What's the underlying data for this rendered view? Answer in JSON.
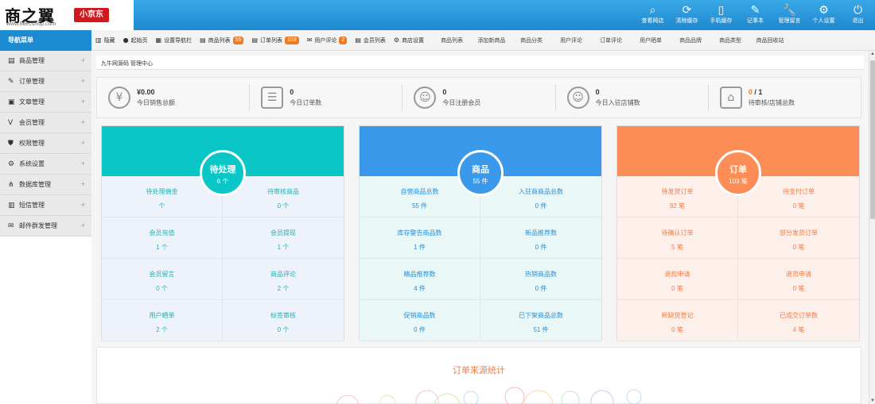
{
  "logo": {
    "main": "商之翼",
    "url": "www.68ecshop.com",
    "badge": "小京东"
  },
  "header_nav": [
    {
      "icon": "search-icon",
      "glyph": "⌕",
      "label": "查看网店"
    },
    {
      "icon": "refresh-icon",
      "glyph": "⟳",
      "label": "清除缓存"
    },
    {
      "icon": "mobile-icon",
      "glyph": "▯",
      "label": "手机缓存"
    },
    {
      "icon": "pen-icon",
      "glyph": "✎",
      "label": "记事本"
    },
    {
      "icon": "wrench-icon",
      "glyph": "🔧",
      "label": "管理留言"
    },
    {
      "icon": "gear-icon",
      "glyph": "⚙",
      "label": "个人设置"
    },
    {
      "icon": "power-icon",
      "glyph": "⏻",
      "label": "退出"
    }
  ],
  "sidebar": {
    "title": "导航菜单",
    "items": [
      {
        "icon": "goods-icon",
        "glyph": "▤",
        "label": "商品管理"
      },
      {
        "icon": "order-icon",
        "glyph": "✎",
        "label": "订单管理"
      },
      {
        "icon": "article-icon",
        "glyph": "▣",
        "label": "文章管理"
      },
      {
        "icon": "vip-icon",
        "glyph": "V",
        "label": "会员管理"
      },
      {
        "icon": "shield-icon",
        "glyph": "⛊",
        "label": "权限管理"
      },
      {
        "icon": "settings-icon",
        "glyph": "⚙",
        "label": "系统设置"
      },
      {
        "icon": "database-icon",
        "glyph": "⋔",
        "label": "数据库管理"
      },
      {
        "icon": "sms-icon",
        "glyph": "▥",
        "label": "短信管理"
      },
      {
        "icon": "mail-icon",
        "glyph": "✉",
        "label": "邮件群发管理"
      }
    ]
  },
  "tabs": [
    {
      "icon": "hide-icon",
      "glyph": "▥",
      "label": "隐藏",
      "badge": ""
    },
    {
      "icon": "home-icon",
      "glyph": "●",
      "label": "起始页",
      "badge": ""
    },
    {
      "icon": "nav-icon",
      "glyph": "▦",
      "label": "设置导航栏",
      "badge": ""
    },
    {
      "icon": "goods-list-icon",
      "glyph": "▤",
      "label": "商品列表",
      "badge": "55"
    },
    {
      "icon": "order-list-icon",
      "glyph": "▤",
      "label": "订单列表",
      "badge": "103"
    },
    {
      "icon": "comment-icon",
      "glyph": "✉",
      "label": "用户评论",
      "badge": "2"
    },
    {
      "icon": "member-icon",
      "glyph": "▤",
      "label": "会员列表",
      "badge": ""
    },
    {
      "icon": "shop-icon",
      "glyph": "⚙",
      "label": "商店设置",
      "badge": ""
    }
  ],
  "plain_tabs": [
    "商品列表",
    "添加新商品",
    "商品分类",
    "用户评论",
    "订单评论",
    "用户晒单",
    "商品品牌",
    "商品类型",
    "商品回收站"
  ],
  "breadcrumb": "九牛网源码 管理中心",
  "stats": [
    {
      "icon": "yen-icon",
      "glyph": "¥",
      "value": "¥0.00",
      "label": "今日销售总额"
    },
    {
      "icon": "clipboard-icon",
      "glyph": "☰",
      "value": "0",
      "label": "今日订单数"
    },
    {
      "icon": "user-icon",
      "glyph": "☺",
      "value": "0",
      "label": "今日注册会员"
    },
    {
      "icon": "users-icon",
      "glyph": "☺",
      "value": "0",
      "label": "今日入驻店铺数"
    },
    {
      "icon": "store-icon",
      "glyph": "⌂",
      "value_hl": "0",
      "value_rest": " / 1",
      "label": "待审核/店铺总数"
    }
  ],
  "panels": [
    {
      "title": "待处理",
      "count": "6 个",
      "cells": [
        {
          "label": "待处理佣金",
          "value": "个"
        },
        {
          "label": "待审核商品",
          "value": "0 个"
        },
        {
          "label": "会员充值",
          "value": "1 个"
        },
        {
          "label": "会员提现",
          "value": "1 个"
        },
        {
          "label": "会员留言",
          "value": "0 个"
        },
        {
          "label": "商品评论",
          "value": "2 个"
        },
        {
          "label": "用户晒单",
          "value": "2 个"
        },
        {
          "label": "标签审核",
          "value": "0 个"
        }
      ]
    },
    {
      "title": "商品",
      "count": "55 件",
      "cells": [
        {
          "label": "自营商品总数",
          "value": "55 件"
        },
        {
          "label": "入驻商商品总数",
          "value": "0 件"
        },
        {
          "label": "库存警告商品数",
          "value": "1 件"
        },
        {
          "label": "新品推荐数",
          "value": "0 件"
        },
        {
          "label": "精品推荐数",
          "value": "4 件"
        },
        {
          "label": "热销商品数",
          "value": "0 件"
        },
        {
          "label": "促销商品数",
          "value": "0 件"
        },
        {
          "label": "已下架商品总数",
          "value": "51 件"
        }
      ]
    },
    {
      "title": "订单",
      "count": "103 笔",
      "cells": [
        {
          "label": "待发货订单",
          "value": "92 笔"
        },
        {
          "label": "待支付订单",
          "value": "0 笔"
        },
        {
          "label": "待确认订单",
          "value": "5 笔"
        },
        {
          "label": "部分发货订单",
          "value": "0 笔"
        },
        {
          "label": "退款申请",
          "value": "0 笔"
        },
        {
          "label": "退货申请",
          "value": "0 笔"
        },
        {
          "label": "新缺货登记",
          "value": "0 笔"
        },
        {
          "label": "已成交订单数",
          "value": "4 笔"
        }
      ]
    }
  ],
  "chart_section": {
    "title": "订单来源统计"
  },
  "colors": {
    "header": "#1e88cf",
    "cyan": "#0ac6c6",
    "blue": "#3a99ea",
    "orange": "#fd8d56",
    "badge": "#f07b22"
  }
}
